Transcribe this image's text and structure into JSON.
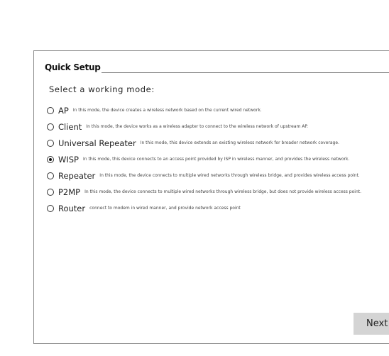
{
  "quick_setup": {
    "title": "Quick Setup",
    "subtitle": "Select a working mode:",
    "modes": [
      {
        "name": "AP",
        "description": "In this mode, the device creates a wireless network based on the current wired network.",
        "selected": false
      },
      {
        "name": "Client",
        "description": "In this mode, the device works as a wireless adapter to connect to the wireless network of upstream AP.",
        "selected": false
      },
      {
        "name": "Universal Repeater",
        "description": "In this mode, this device extends an existing wireless network for broader network coverage.",
        "selected": false
      },
      {
        "name": "WISP",
        "description": "In this mode, this device connects to an access point provided by ISP in wireless manner, and provides the wireless network.",
        "selected": true
      },
      {
        "name": "Repeater",
        "description": "In this mode, the device connects to multiple wired networks through wireless bridge, and provides wireless access point.",
        "selected": false
      },
      {
        "name": "P2MP",
        "description": "In this mode, the device connects to multiple wired networks through wireless bridge, but does not provide wireless access point.",
        "selected": false
      },
      {
        "name": "Router",
        "description": "connect to modem in wired manner, and provide network access point",
        "selected": false
      }
    ],
    "next_label": "Next"
  }
}
